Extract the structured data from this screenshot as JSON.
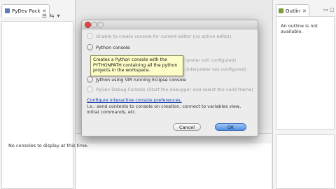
{
  "left_panel": {
    "tab_label": "PyDev Pack",
    "close_glyph": "✕",
    "toolbar_icons": [
      "collapse-all-icon",
      "link-with-editor-icon",
      "view-menu-icon"
    ]
  },
  "right_panel": {
    "tab_label": "Outlin",
    "close_glyph": "✕",
    "minmax_glyph": "▭ ▢",
    "message": "An outline is not available."
  },
  "console": {
    "message": "No consoles to display at this time."
  },
  "dialog": {
    "options": [
      {
        "label": "Unable to create console for current editor (no active editor)",
        "enabled": false
      },
      {
        "label": "Python console",
        "enabled": true
      },
      {
        "label": "",
        "enabled": false,
        "suffix": "rpreter not configured)"
      },
      {
        "label": "",
        "enabled": false,
        "suffix": "(interpreter not configured)"
      },
      {
        "label": "Jython using VM running Eclipse console",
        "enabled": true
      },
      {
        "label": "PyDev Debug Console (Start the debugger and select the valid frame)",
        "enabled": false
      }
    ],
    "tooltip": "Creates a Python console with the PYTHONPATH containing all the python projects in the workspace.",
    "config_link": "Configure interactive console preferences.",
    "config_desc": "I.e.: send contents to console on creation, connect to variables view, initial commands, etc.",
    "cancel_label": "Cancel",
    "ok_label": "OK"
  },
  "colors": {
    "accent": "#4f8ee0",
    "tooltip_bg": "#fdfdc8",
    "link": "#1a3fb0"
  }
}
